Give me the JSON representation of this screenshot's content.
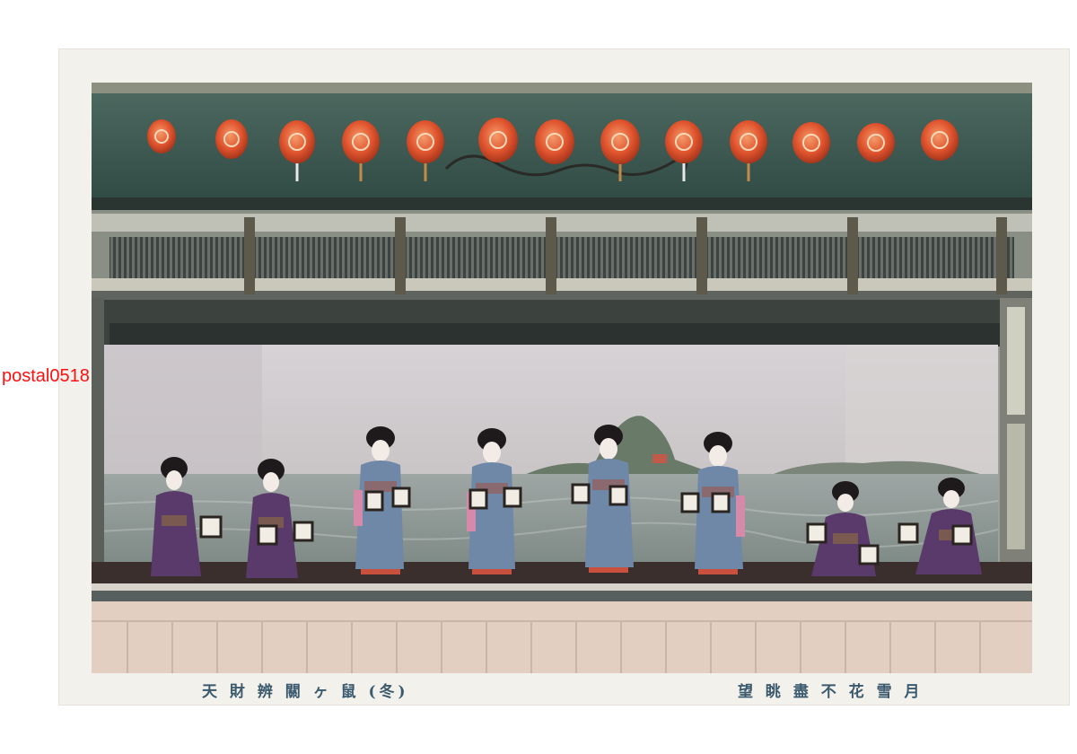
{
  "watermark": "postal0518",
  "caption_left": "天 財 辨 關 ヶ 鼠 (冬)",
  "caption_right": "望 眺 盡 不 花 雪 月",
  "colors": {
    "lantern": "#e0542e",
    "kimono_purple": "#5a3a6a",
    "kimono_blue": "#6f88a8",
    "caption": "#3b5a6e",
    "watermark": "#ff1010"
  }
}
